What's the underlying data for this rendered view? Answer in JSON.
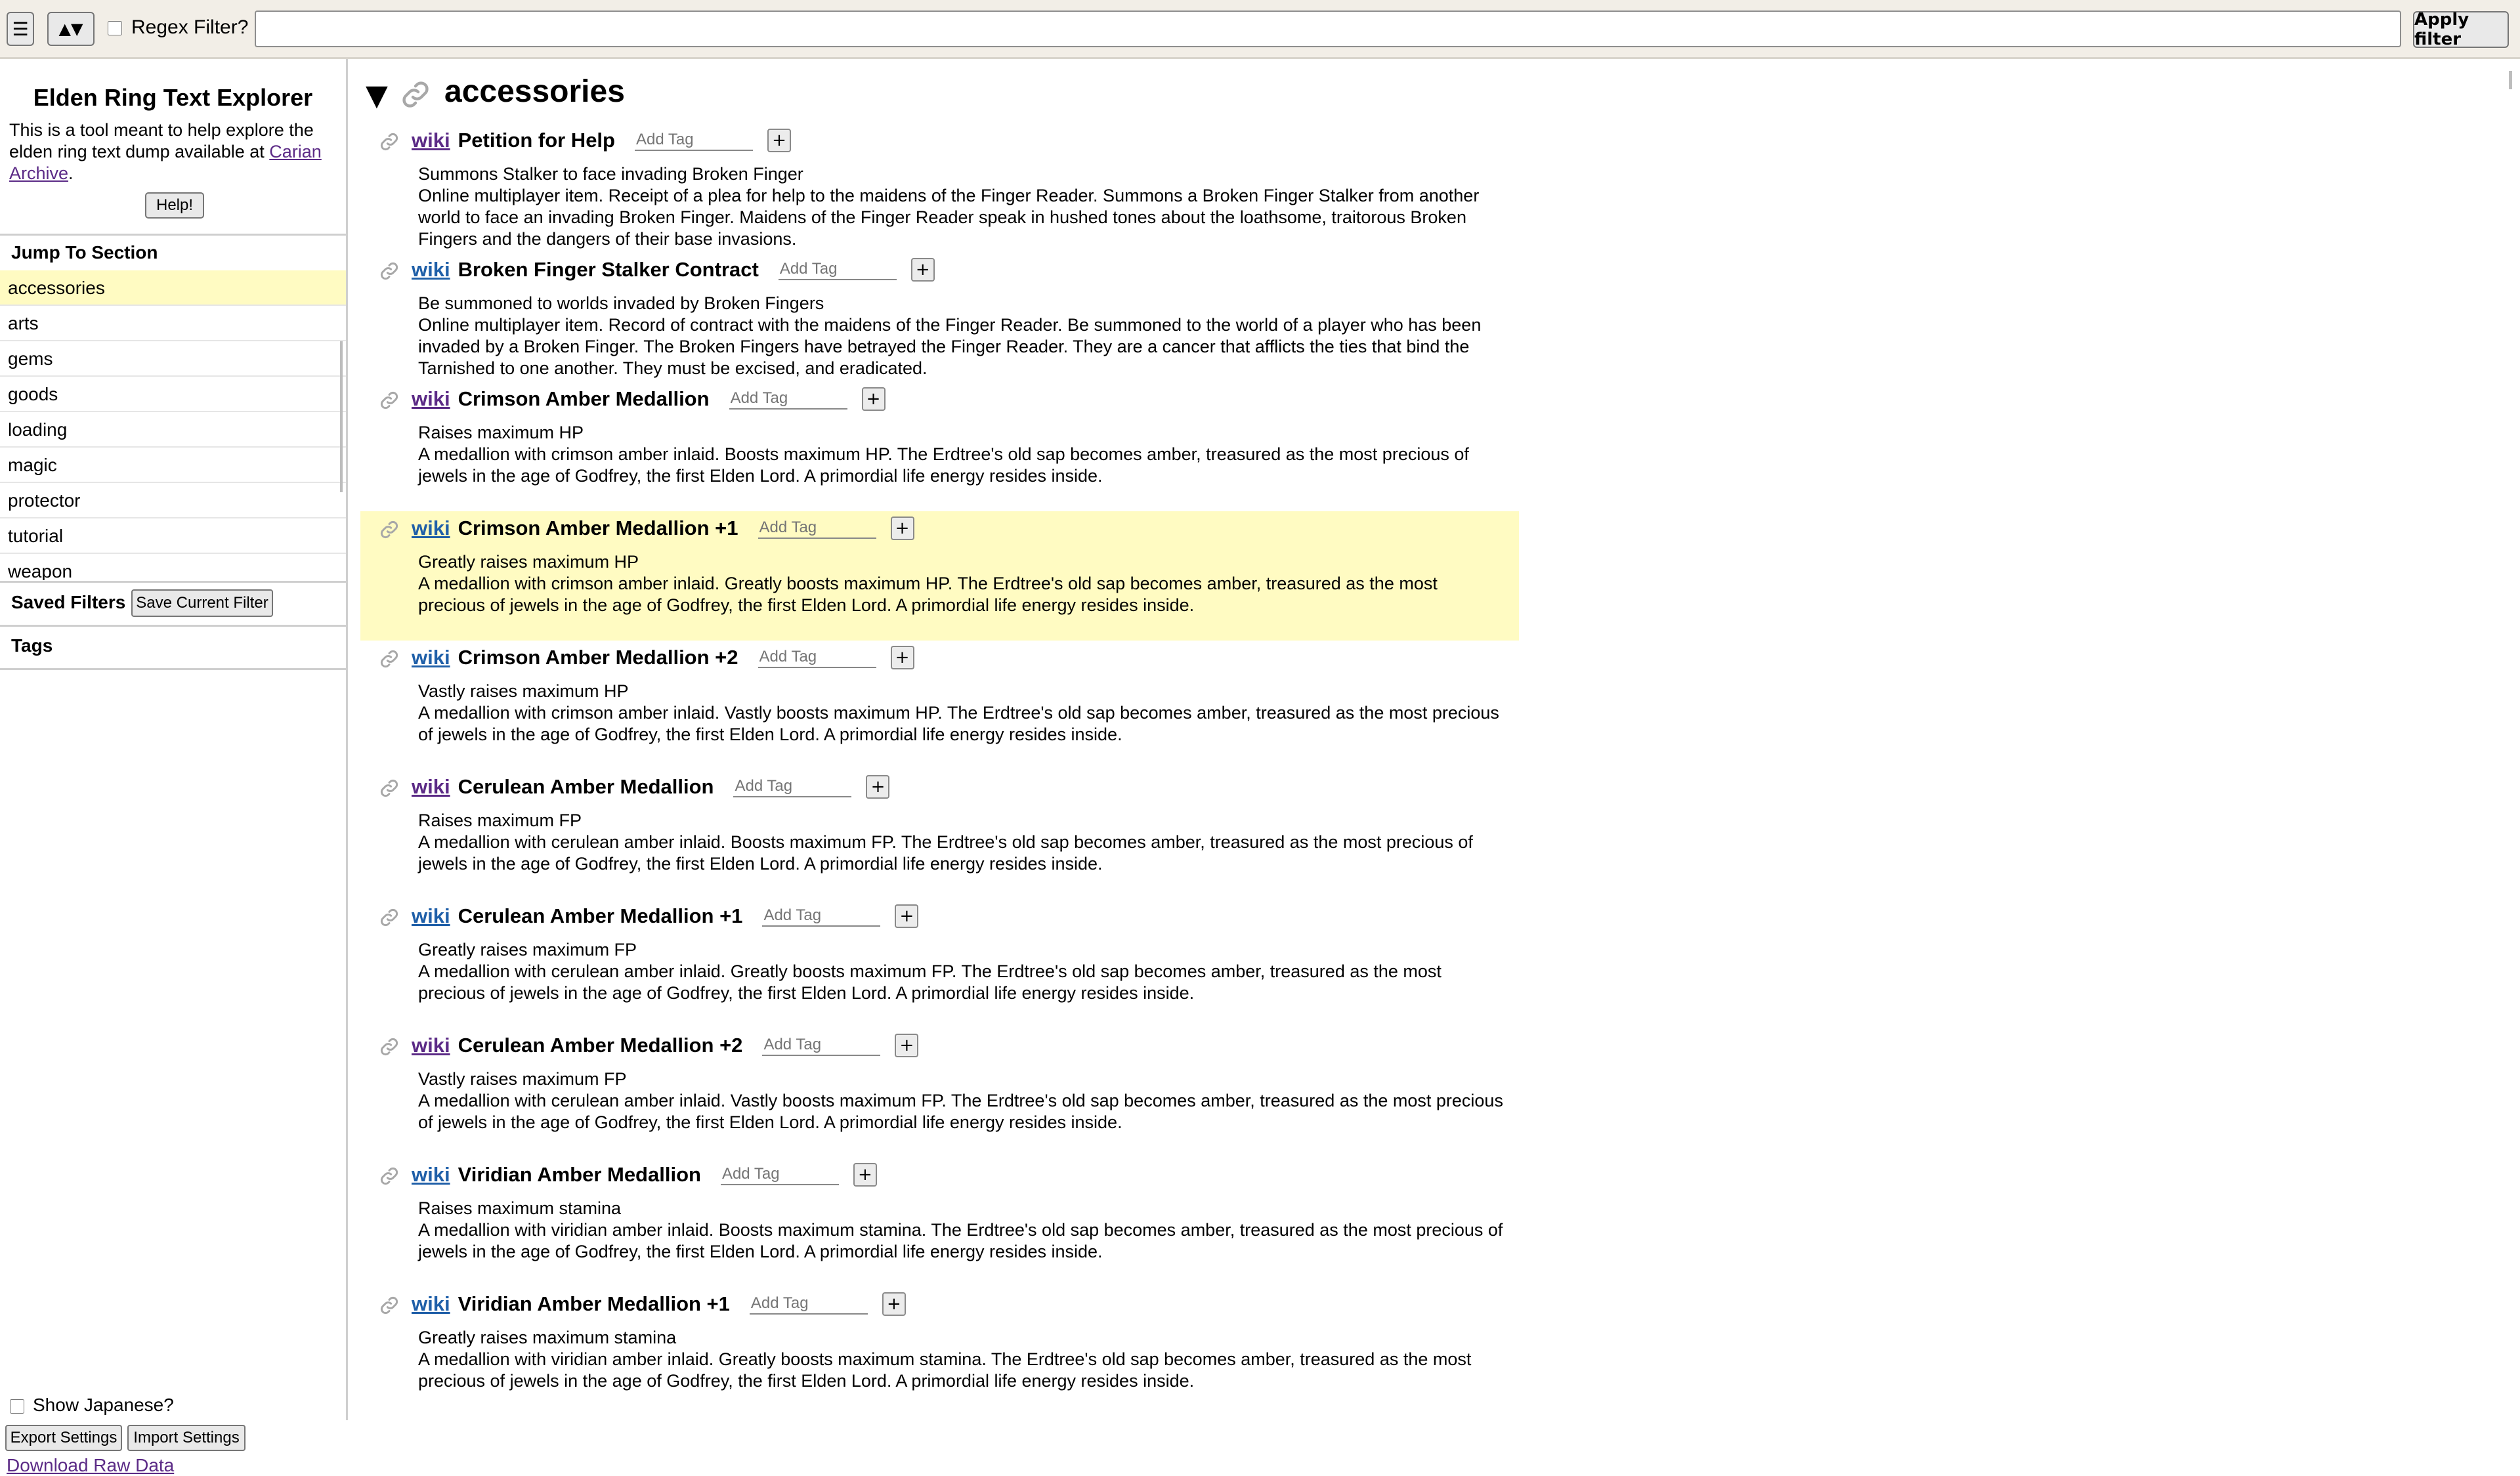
{
  "toolbar": {
    "menu_icon": "☰",
    "sort_icon": "▲▼",
    "regex_label": "Regex Filter?",
    "filter_value": "",
    "apply_label": "Apply filter"
  },
  "sidebar": {
    "title": "Elden Ring Text Explorer",
    "desc_pre": "This is a tool meant to help explore the elden ring text dump available at ",
    "desc_link": "Carian Archive",
    "desc_post": ".",
    "help_label": "Help!",
    "jump_heading": "Jump To Section",
    "sections": [
      "accessories",
      "arts",
      "gems",
      "goods",
      "loading",
      "magic",
      "protector",
      "tutorial",
      "weapon"
    ],
    "active_section": "accessories",
    "saved_heading": "Saved Filters",
    "save_filter_label": "Save Current Filter",
    "tags_heading": "Tags",
    "show_japanese_label": "Show Japanese?",
    "export_label": "Export Settings",
    "import_label": "Import Settings",
    "download_label": "Download Raw Data"
  },
  "main": {
    "toggle_icon": "▼",
    "section_title": "accessories",
    "tag_placeholder": "Add Tag",
    "add_tag_label": "+",
    "entries": [
      {
        "wiki": "wiki",
        "name": "Petition for Help",
        "caption": "Summons Stalker to face invading Broken Finger",
        "desc": "Online multiplayer item. Receipt of a plea for help to the maidens of the Finger Reader. Summons a Broken Finger Stalker from another world to face an invading Broken Finger. Maidens of the Finger Reader speak in hushed tones about the loathsome, traitorous Broken Fingers and the dangers of their base invasions.",
        "visited": true,
        "highlight": false
      },
      {
        "wiki": "wiki",
        "name": "Broken Finger Stalker Contract",
        "caption": "Be summoned to worlds invaded by Broken Fingers",
        "desc": "Online multiplayer item. Record of contract with the maidens of the Finger Reader. Be summoned to the world of a player who has been invaded by a Broken Finger. The Broken Fingers have betrayed the Finger Reader. They are a cancer that afflicts the ties that bind the Tarnished to one another. They must be excised, and eradicated.",
        "visited": false,
        "highlight": false
      },
      {
        "wiki": "wiki",
        "name": "Crimson Amber Medallion",
        "caption": "Raises maximum HP",
        "desc": "A medallion with crimson amber inlaid. Boosts maximum HP. The Erdtree's old sap becomes amber, treasured as the most precious of jewels in the age of Godfrey, the first Elden Lord. A primordial life energy resides inside.",
        "visited": true,
        "highlight": false
      },
      {
        "wiki": "wiki",
        "name": "Crimson Amber Medallion +1",
        "caption": "Greatly raises maximum HP",
        "desc": "A medallion with crimson amber inlaid. Greatly boosts maximum HP. The Erdtree's old sap becomes amber, treasured as the most precious of jewels in the age of Godfrey, the first Elden Lord. A primordial life energy resides inside.",
        "visited": false,
        "highlight": true
      },
      {
        "wiki": "wiki",
        "name": "Crimson Amber Medallion +2",
        "caption": "Vastly raises maximum HP",
        "desc": "A medallion with crimson amber inlaid. Vastly boosts maximum HP. The Erdtree's old sap becomes amber, treasured as the most precious of jewels in the age of Godfrey, the first Elden Lord. A primordial life energy resides inside.",
        "visited": false,
        "highlight": false
      },
      {
        "wiki": "wiki",
        "name": "Cerulean Amber Medallion",
        "caption": "Raises maximum FP",
        "desc": "A medallion with cerulean amber inlaid. Boosts maximum FP. The Erdtree's old sap becomes amber, treasured as the most precious of jewels in the age of Godfrey, the first Elden Lord. A primordial life energy resides inside.",
        "visited": true,
        "highlight": false
      },
      {
        "wiki": "wiki",
        "name": "Cerulean Amber Medallion +1",
        "caption": "Greatly raises maximum FP",
        "desc": "A medallion with cerulean amber inlaid. Greatly boosts maximum FP. The Erdtree's old sap becomes amber, treasured as the most precious of jewels in the age of Godfrey, the first Elden Lord. A primordial life energy resides inside.",
        "visited": false,
        "highlight": false
      },
      {
        "wiki": "wiki",
        "name": "Cerulean Amber Medallion +2",
        "caption": "Vastly raises maximum FP",
        "desc": "A medallion with cerulean amber inlaid. Vastly boosts maximum FP. The Erdtree's old sap becomes amber, treasured as the most precious of jewels in the age of Godfrey, the first Elden Lord. A primordial life energy resides inside.",
        "visited": true,
        "highlight": false
      },
      {
        "wiki": "wiki",
        "name": "Viridian Amber Medallion",
        "caption": "Raises maximum stamina",
        "desc": "A medallion with viridian amber inlaid. Boosts maximum stamina. The Erdtree's old sap becomes amber, treasured as the most precious of jewels in the age of Godfrey, the first Elden Lord. A primordial life energy resides inside.",
        "visited": false,
        "highlight": false
      },
      {
        "wiki": "wiki",
        "name": "Viridian Amber Medallion +1",
        "caption": "Greatly raises maximum stamina",
        "desc": "A medallion with viridian amber inlaid. Greatly boosts maximum stamina. The Erdtree's old sap becomes amber, treasured as the most precious of jewels in the age of Godfrey, the first Elden Lord. A primordial life energy resides inside.",
        "visited": false,
        "highlight": false
      }
    ]
  }
}
